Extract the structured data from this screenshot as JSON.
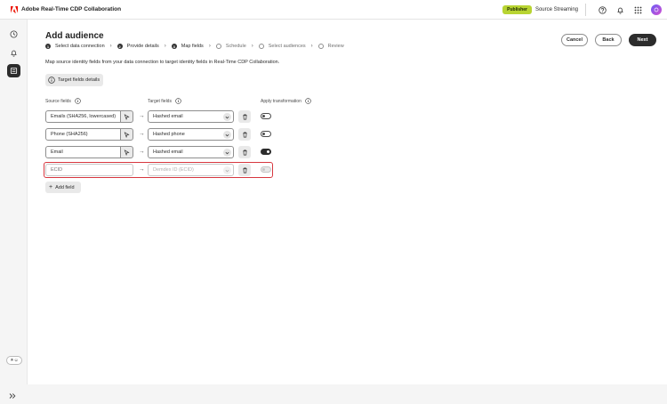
{
  "app": {
    "title": "Adobe Real-Time CDP Collaboration"
  },
  "header": {
    "badge": "Publisher",
    "org": "Source Streaming"
  },
  "page": {
    "title": "Add audience",
    "description": "Map source identity fields from your data connection to target identity fields in Real-Time CDP Collaboration."
  },
  "steps": [
    {
      "num": "1",
      "label": "Select data connection",
      "state": "done"
    },
    {
      "num": "2",
      "label": "Provide details",
      "state": "done"
    },
    {
      "num": "3",
      "label": "Map fields",
      "state": "current"
    },
    {
      "num": "",
      "label": "Schedule",
      "state": "pending"
    },
    {
      "num": "",
      "label": "Select audiences",
      "state": "pending"
    },
    {
      "num": "",
      "label": "Review",
      "state": "pending"
    }
  ],
  "actions": {
    "cancel": "Cancel",
    "back": "Back",
    "next": "Next"
  },
  "details_button": "Target fields details",
  "columns": {
    "source": "Source fields",
    "target": "Target fields",
    "transform": "Apply transformation"
  },
  "mappings": [
    {
      "source": "Emails (SHA256, lowercased)",
      "target": "Hashed email",
      "transform": false
    },
    {
      "source": "Phone (SHA256)",
      "target": "Hashed phone",
      "transform": false
    },
    {
      "source": "Email",
      "target": "Hashed email",
      "transform": true
    },
    {
      "source_placeholder": "ECID",
      "target_placeholder": "Demdex ID (ECID)",
      "transform": false,
      "disabled": true
    }
  ],
  "add_field": "Add field",
  "colors": {
    "error": "#d7373f",
    "badge": "#b8d432",
    "primary": "#2c2c2c"
  }
}
